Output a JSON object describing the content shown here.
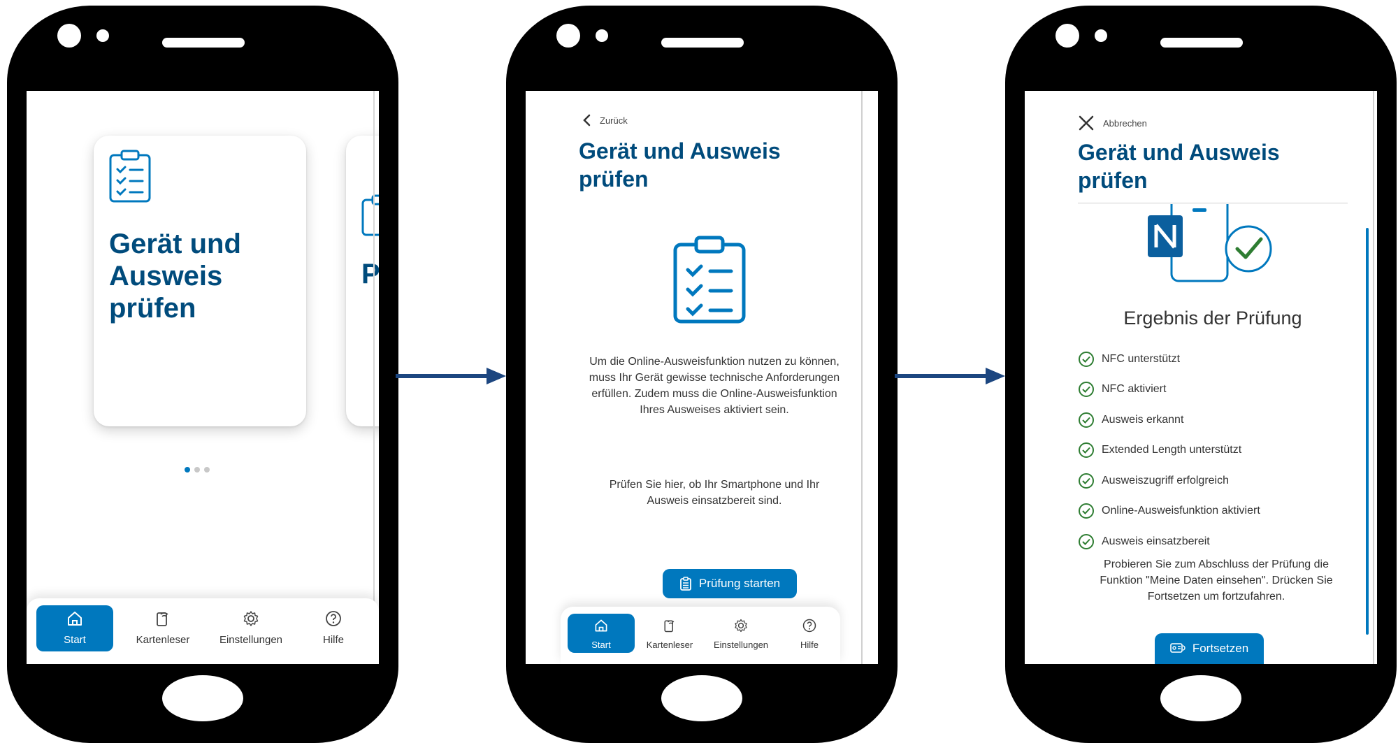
{
  "phone1": {
    "card_title": "Gerät und Ausweis prüfen",
    "card2_letter": "P",
    "nav": {
      "start": "Start",
      "cardreader": "Kartenleser",
      "settings": "Einstellungen",
      "help": "Hilfe"
    }
  },
  "phone2": {
    "back_label": "Zurück",
    "title": "Gerät und Ausweis prüfen",
    "intro_text": "Um die Online-Ausweisfunktion nutzen zu können, muss Ihr Gerät gewisse technische Anforderungen erfüllen. Zudem muss die Online-Ausweisfunktion Ihres Ausweises aktiviert sein.",
    "check_text": "Prüfen Sie hier, ob Ihr Smartphone und Ihr Ausweis einsatzbereit sind.",
    "start_button": "Prüfung starten",
    "nav": {
      "start": "Start",
      "cardreader": "Kartenleser",
      "settings": "Einstellungen",
      "help": "Hilfe"
    }
  },
  "phone3": {
    "cancel_label": "Abbrechen",
    "title": "Gerät und Ausweis prüfen",
    "result_title": "Ergebnis der Prüfung",
    "checks": [
      "NFC unterstützt",
      "NFC aktiviert",
      "Ausweis erkannt",
      "Extended Length unterstützt",
      "Ausweiszugriff erfolgreich",
      "Online-Ausweisfunktion aktiviert",
      "Ausweis einsatzbereit"
    ],
    "note": "Probieren Sie zum Abschluss der Prüfung die Funktion \"Meine Daten einsehen\". Drücken Sie Fortsetzen um fortzufahren.",
    "continue_button": "Fortsetzen"
  },
  "colors": {
    "brand_blue": "#0078be",
    "title_blue": "#004b7c",
    "arrow_blue": "#1c4680",
    "check_green": "#2e7d32"
  }
}
